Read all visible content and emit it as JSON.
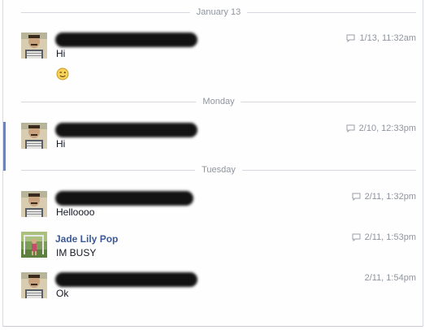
{
  "dividers": {
    "d1": "January 13",
    "d2": "Monday",
    "d3": "Tuesday"
  },
  "messages": [
    {
      "sender": "redacted",
      "text": "Hi",
      "time": "1/13, 11:32am",
      "has_chat_icon": true,
      "emoticon": "wink-smiley-icon"
    },
    {
      "sender": "redacted",
      "text": "Hi",
      "time": "2/10, 12:33pm",
      "has_chat_icon": true
    },
    {
      "sender": "redacted",
      "text": "Helloooo",
      "time": "2/11, 1:32pm",
      "has_chat_icon": true
    },
    {
      "sender": "Jade Lily Pop",
      "text": "IM BUSY",
      "time": "2/11, 1:53pm",
      "has_chat_icon": true
    },
    {
      "sender": "redacted",
      "text": "Ok",
      "time": "2/11, 1:54pm",
      "has_chat_icon": false
    }
  ],
  "colors": {
    "accent": "#3b5998",
    "selected_bar": "#6d84b4",
    "meta_text": "#8f949e"
  }
}
